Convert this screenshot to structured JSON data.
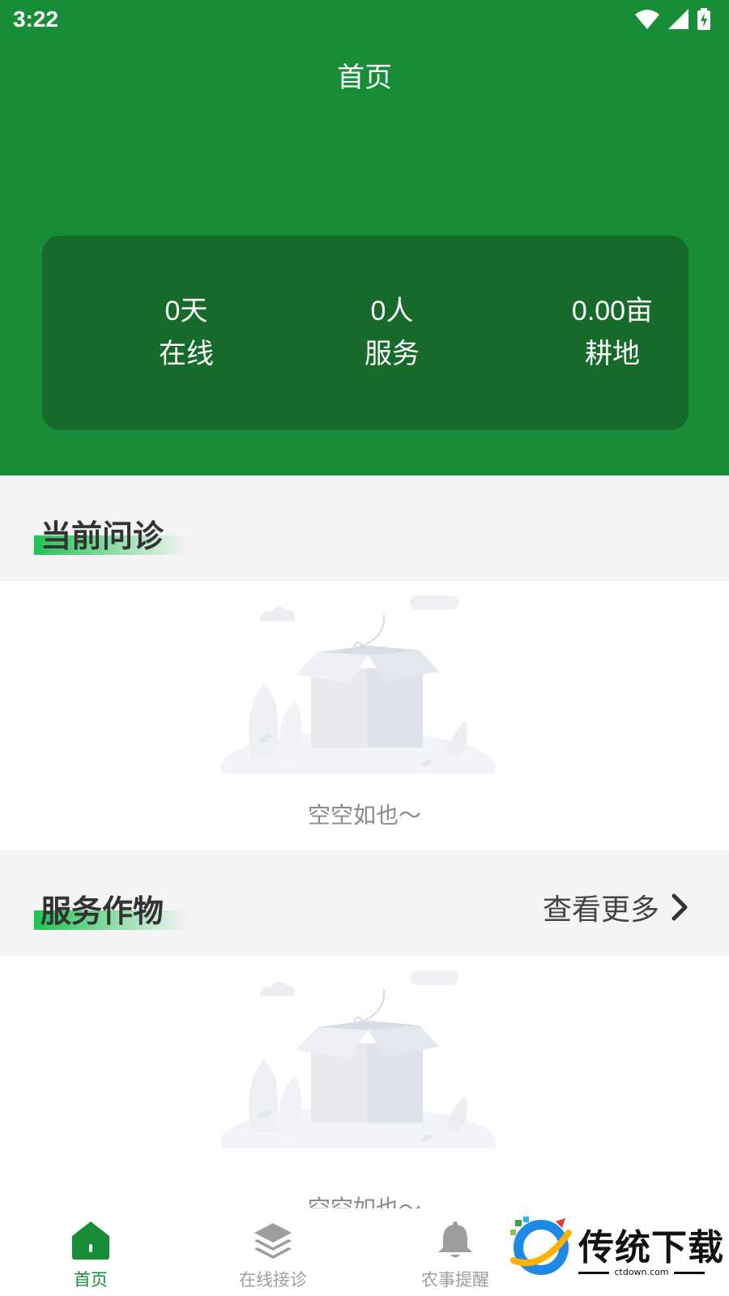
{
  "status_bar": {
    "time": "3:22"
  },
  "header": {
    "title": "首页"
  },
  "stats": [
    {
      "value": "0天",
      "label": "在线"
    },
    {
      "value": "0人",
      "label": "服务"
    },
    {
      "value": "0.00亩",
      "label": "耕地"
    }
  ],
  "current_consult": {
    "title": "当前问诊",
    "empty_text": "空空如也～"
  },
  "service_crops": {
    "title": "服务作物",
    "more_label": "查看更多",
    "empty_text": "空空如也～"
  },
  "tabbar": {
    "active_color": "#188d38",
    "inactive_color": "#9e9e9e",
    "items": [
      {
        "label": "首页",
        "icon": "home-icon",
        "active": true
      },
      {
        "label": "在线接诊",
        "icon": "layers-icon",
        "active": false
      },
      {
        "label": "农事提醒",
        "icon": "bell-icon",
        "active": false
      }
    ]
  },
  "watermark": {
    "text": "传统下载",
    "sub": "ctdown.com"
  },
  "colors": {
    "header_green": "#188d38",
    "card_green": "#166a2a",
    "section_bg": "#f4f4f4"
  }
}
